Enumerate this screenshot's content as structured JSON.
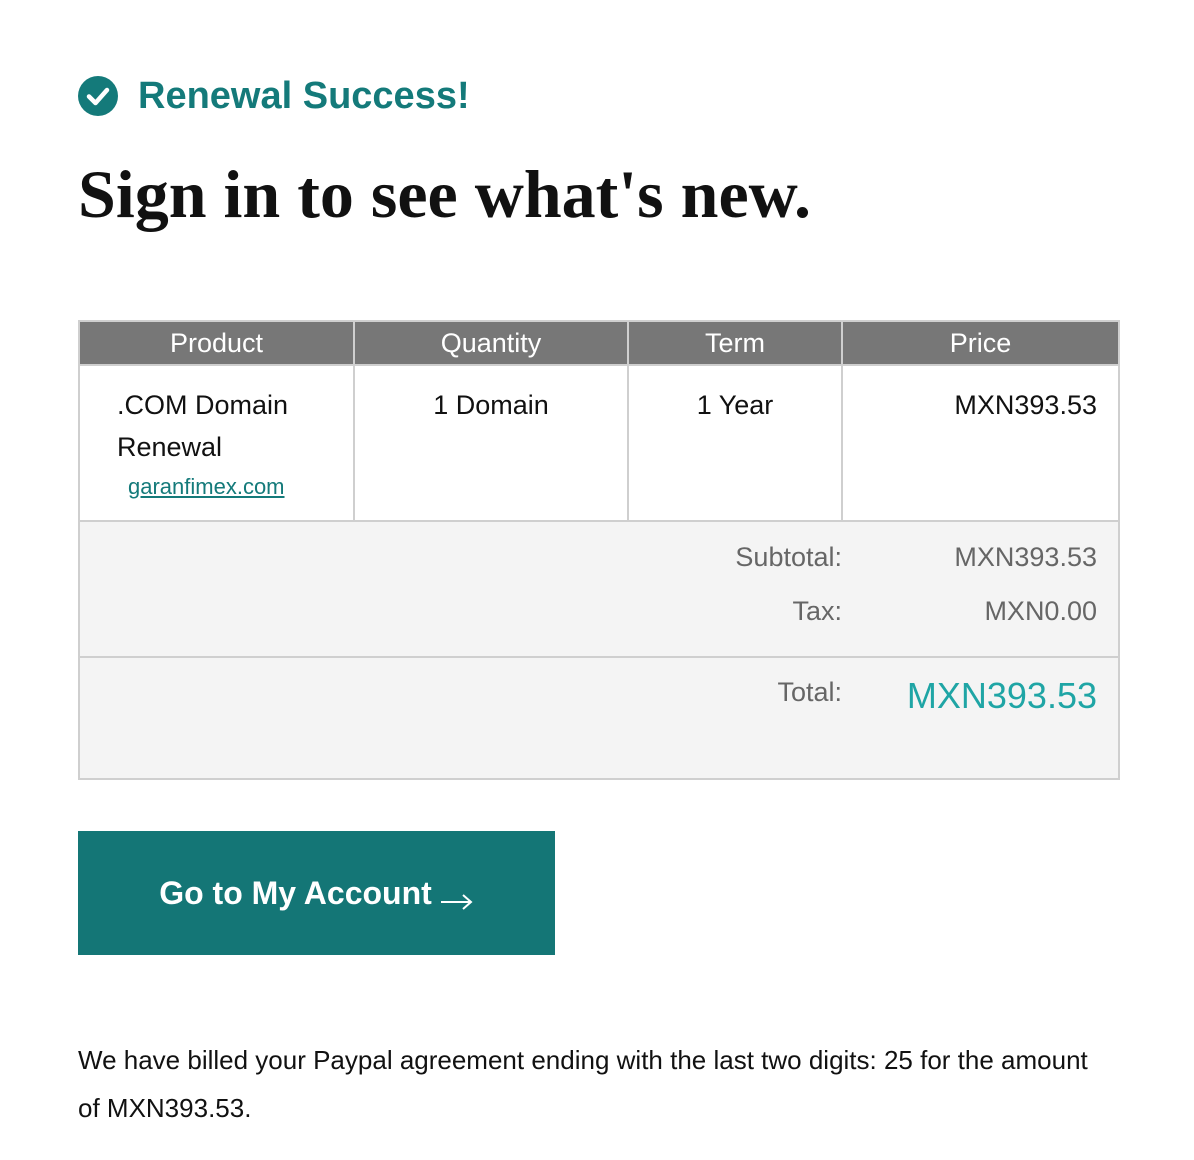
{
  "status": {
    "text": "Renewal Success!",
    "icon": "check-circle-icon",
    "color": "#147a7a"
  },
  "headline": "Sign in to see what's new.",
  "order_table": {
    "headers": [
      "Product",
      "Quantity",
      "Term",
      "Price"
    ],
    "row": {
      "product_name": ".COM Domain Renewal",
      "domain": "garanfimex.com",
      "quantity": "1 Domain",
      "term": "1 Year",
      "price": "MXN393.53"
    },
    "summary": {
      "subtotal_label": "Subtotal:",
      "subtotal_value": "MXN393.53",
      "tax_label": "Tax:",
      "tax_value": "MXN0.00",
      "total_label": "Total:",
      "total_value": "MXN393.53"
    }
  },
  "cta": {
    "label": "Go to My Account",
    "icon": "arrow-right-icon",
    "color": "#147676"
  },
  "billing_note": "We have billed your Paypal agreement ending with the last two digits: 25 for the amount of MXN393.53."
}
